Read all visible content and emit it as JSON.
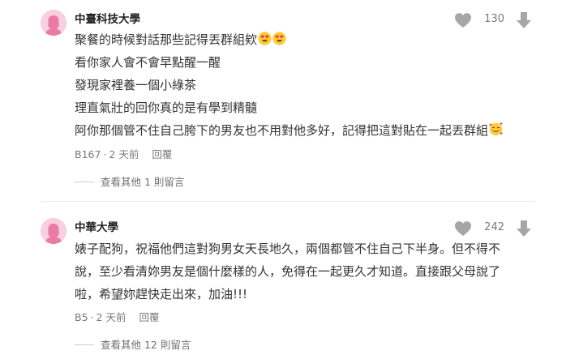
{
  "comments": [
    {
      "school": "中臺科技大學",
      "likes": "130",
      "lines": [
        "聚餐的時候對話那些記得丟群組欸",
        "看你家人會不會早點醒一醒",
        "發現家裡養一個小綠茶",
        "理直氣壯的回你真的是有學到精髓",
        "阿你那個管不住自己胯下的男友也不用對他多好，記得把這對貼在一起丟群組"
      ],
      "emojis": [
        "heart-eyes-emoji",
        "heart-eyes-emoji",
        "smiling-face-with-hearts-emoji"
      ],
      "floor": "B167",
      "time": "2 天前",
      "reply_label": "回覆",
      "more_replies": "查看其他 1 則留言"
    },
    {
      "school": "中華大學",
      "likes": "242",
      "lines": [
        "婊子配狗，祝福他們這對狗男女天長地久，兩個都管不住自己下半身。但不得不",
        "說，至少看清妳男友是個什麼樣的人，免得在一起更久才知道。直接跟父母說了",
        "啦，希望妳趕快走出來，加油!!!"
      ],
      "floor": "B5",
      "time": "2 天前",
      "reply_label": "回覆",
      "more_replies": "查看其他 12 則留言"
    }
  ],
  "meta_separator": "·",
  "colors": {
    "avatar_bg": "#f8cfe0",
    "avatar_figure": "#ea7aa6",
    "icon_gray": "#a6a6a6",
    "divider": "#ebebeb"
  }
}
